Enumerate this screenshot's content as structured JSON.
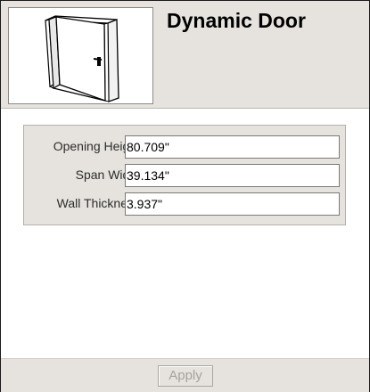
{
  "window": {
    "title": "Dynamic Door"
  },
  "preview": {
    "icon": "door-icon"
  },
  "fields": [
    {
      "label": "Opening Height",
      "value": "80.709\""
    },
    {
      "label": "Span Width",
      "value": "39.134\""
    },
    {
      "label": "Wall Thickness",
      "value": "3.937\""
    }
  ],
  "footer": {
    "apply_label": "Apply",
    "apply_enabled": false
  },
  "colors": {
    "panel_background": "#e6e3de",
    "disabled_text": "#a5a29e"
  }
}
